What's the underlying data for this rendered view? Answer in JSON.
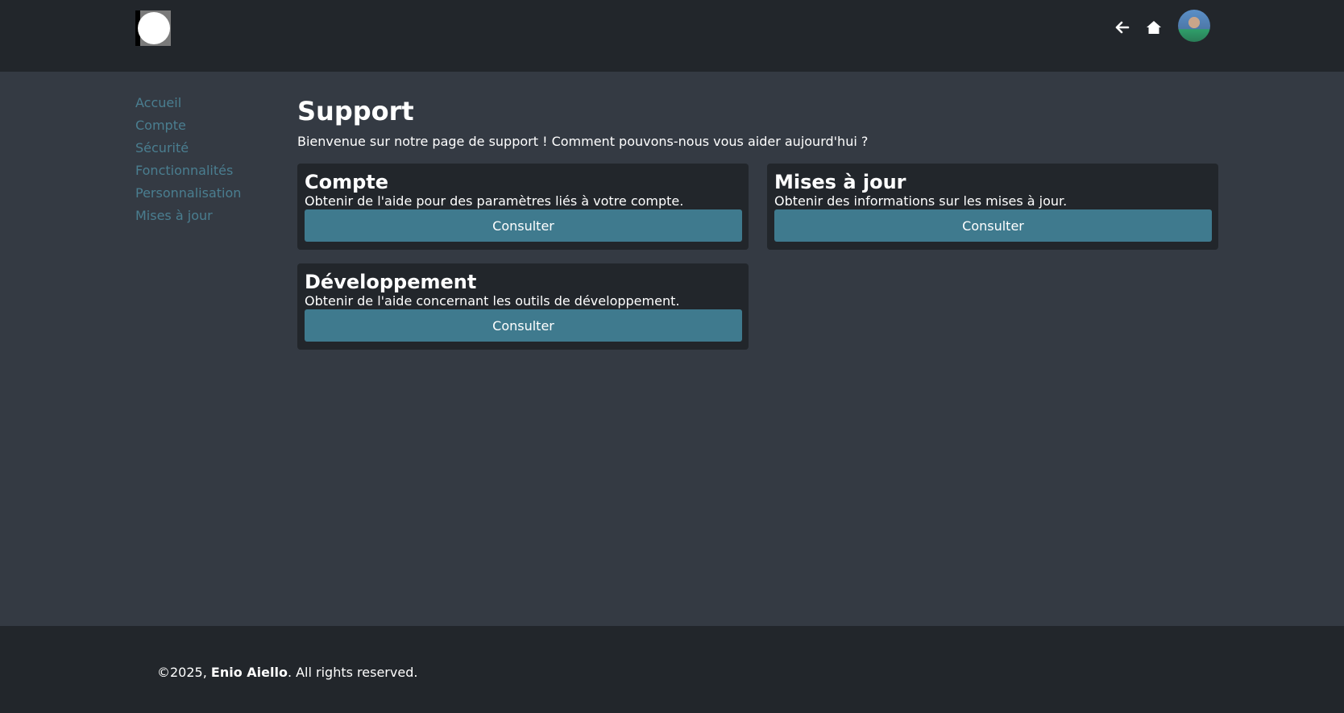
{
  "header": {
    "logo_icon": "circle-logo-icon",
    "back_icon": "arrow-left-icon",
    "home_icon": "home-icon",
    "avatar": "user-avatar"
  },
  "sidebar": {
    "items": [
      {
        "label": "Accueil"
      },
      {
        "label": "Compte"
      },
      {
        "label": "Sécurité"
      },
      {
        "label": "Fonctionnalités"
      },
      {
        "label": "Personnalisation"
      },
      {
        "label": "Mises à jour"
      }
    ]
  },
  "main": {
    "title": "Support",
    "intro": "Bienvenue sur notre page de support ! Comment pouvons-nous vous aider aujourd'hui ?",
    "cards": [
      {
        "title": "Compte",
        "description": "Obtenir de l'aide pour des paramètres liés à votre compte.",
        "button": "Consulter"
      },
      {
        "title": "Mises à jour",
        "description": "Obtenir des informations sur les mises à jour.",
        "button": "Consulter"
      },
      {
        "title": "Développement",
        "description": "Obtenir de l'aide concernant les outils de développement.",
        "button": "Consulter"
      }
    ]
  },
  "footer": {
    "copyright_prefix": "©2025, ",
    "author": "Enio Aiello",
    "copyright_suffix": ". All rights reserved."
  },
  "colors": {
    "header_bg": "#22262b",
    "page_bg": "#343a43",
    "card_bg": "#22262b",
    "button_bg": "#3f7a8e",
    "sidebar_link": "#4a7e90"
  }
}
